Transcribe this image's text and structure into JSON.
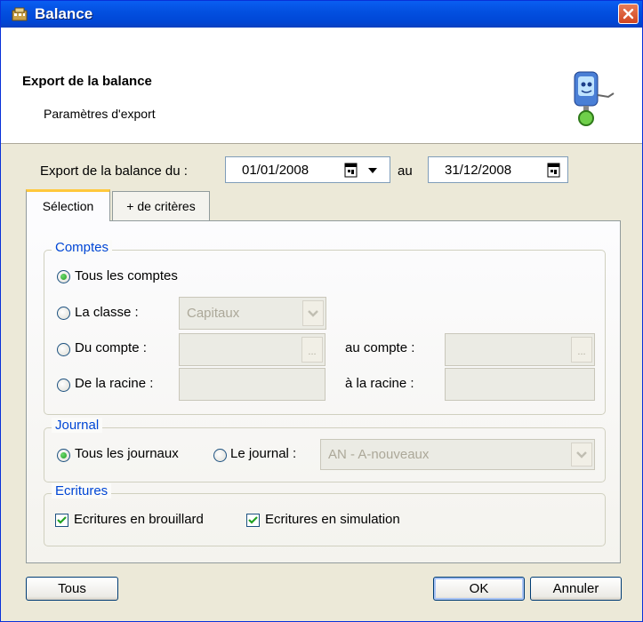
{
  "window": {
    "title": "Balance",
    "accent": "#0046d5"
  },
  "header": {
    "title": "Export de la balance",
    "subtitle": "Paramètres d'export"
  },
  "period": {
    "label_from": "Export de la balance du :",
    "date_from": "01/01/2008",
    "label_to": "au",
    "date_to": "31/12/2008"
  },
  "tabs": [
    {
      "label": "Sélection",
      "active": true
    },
    {
      "label": "+ de critères",
      "active": false
    }
  ],
  "comptes": {
    "legend": "Comptes",
    "all": "Tous les comptes",
    "classe_label": "La classe :",
    "classe_value": "Capitaux",
    "du_compte": "Du compte :",
    "au_compte": "au compte :",
    "ellipsis": "...",
    "de_racine": "De la racine :",
    "a_racine": "à la racine :"
  },
  "journal": {
    "legend": "Journal",
    "all": "Tous les journaux",
    "one": "Le journal :",
    "value": "AN - A-nouveaux"
  },
  "ecritures": {
    "legend": "Ecritures",
    "brouillard": "Ecritures en brouillard",
    "simulation": "Ecritures en simulation"
  },
  "buttons": {
    "tous": "Tous",
    "ok": "OK",
    "annuler": "Annuler"
  }
}
